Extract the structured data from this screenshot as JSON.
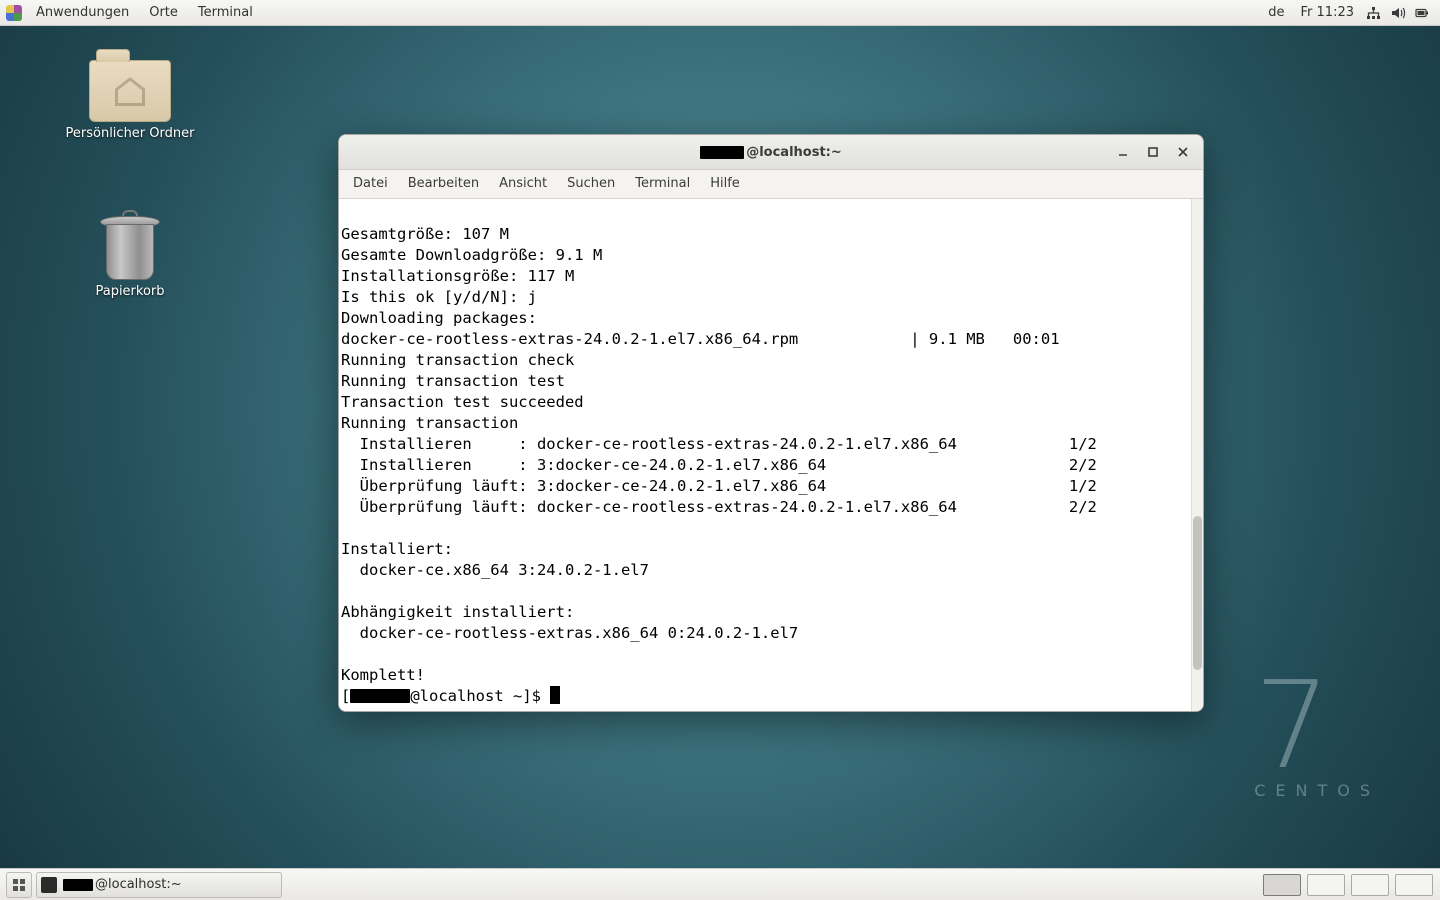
{
  "top_panel": {
    "apps": "Anwendungen",
    "places": "Orte",
    "terminal": "Terminal",
    "layout": "de",
    "clock": "Fr 11:23"
  },
  "desktop": {
    "home": "Persönlicher Ordner",
    "trash": "Papierkorb"
  },
  "centos": {
    "seven": "7",
    "name": "CENTOS"
  },
  "window": {
    "title_suffix": "@localhost:~",
    "menus": {
      "file": "Datei",
      "edit": "Bearbeiten",
      "view": "Ansicht",
      "search": "Suchen",
      "terminal": "Terminal",
      "help": "Hilfe"
    }
  },
  "taskbar": {
    "task_suffix": "@localhost:~"
  },
  "term_lines": [
    "Gesamtgröße: 107 M",
    "Gesamte Downloadgröße: 9.1 M",
    "Installationsgröße: 117 M",
    "Is this ok [y/d/N]: j",
    "Downloading packages:",
    "docker-ce-rootless-extras-24.0.2-1.el7.x86_64.rpm            | 9.1 MB   00:01",
    "Running transaction check",
    "Running transaction test",
    "Transaction test succeeded",
    "Running transaction",
    "  Installieren     : docker-ce-rootless-extras-24.0.2-1.el7.x86_64            1/2",
    "  Installieren     : 3:docker-ce-24.0.2-1.el7.x86_64                          2/2",
    "  Überprüfung läuft: 3:docker-ce-24.0.2-1.el7.x86_64                          1/2",
    "  Überprüfung läuft: docker-ce-rootless-extras-24.0.2-1.el7.x86_64            2/2",
    "",
    "Installiert:",
    "  docker-ce.x86_64 3:24.0.2-1.el7",
    "",
    "Abhängigkeit installiert:",
    "  docker-ce-rootless-extras.x86_64 0:24.0.2-1.el7",
    "",
    "Komplett!"
  ],
  "prompt": {
    "open": "[",
    "rest": "@localhost ~]$ "
  }
}
